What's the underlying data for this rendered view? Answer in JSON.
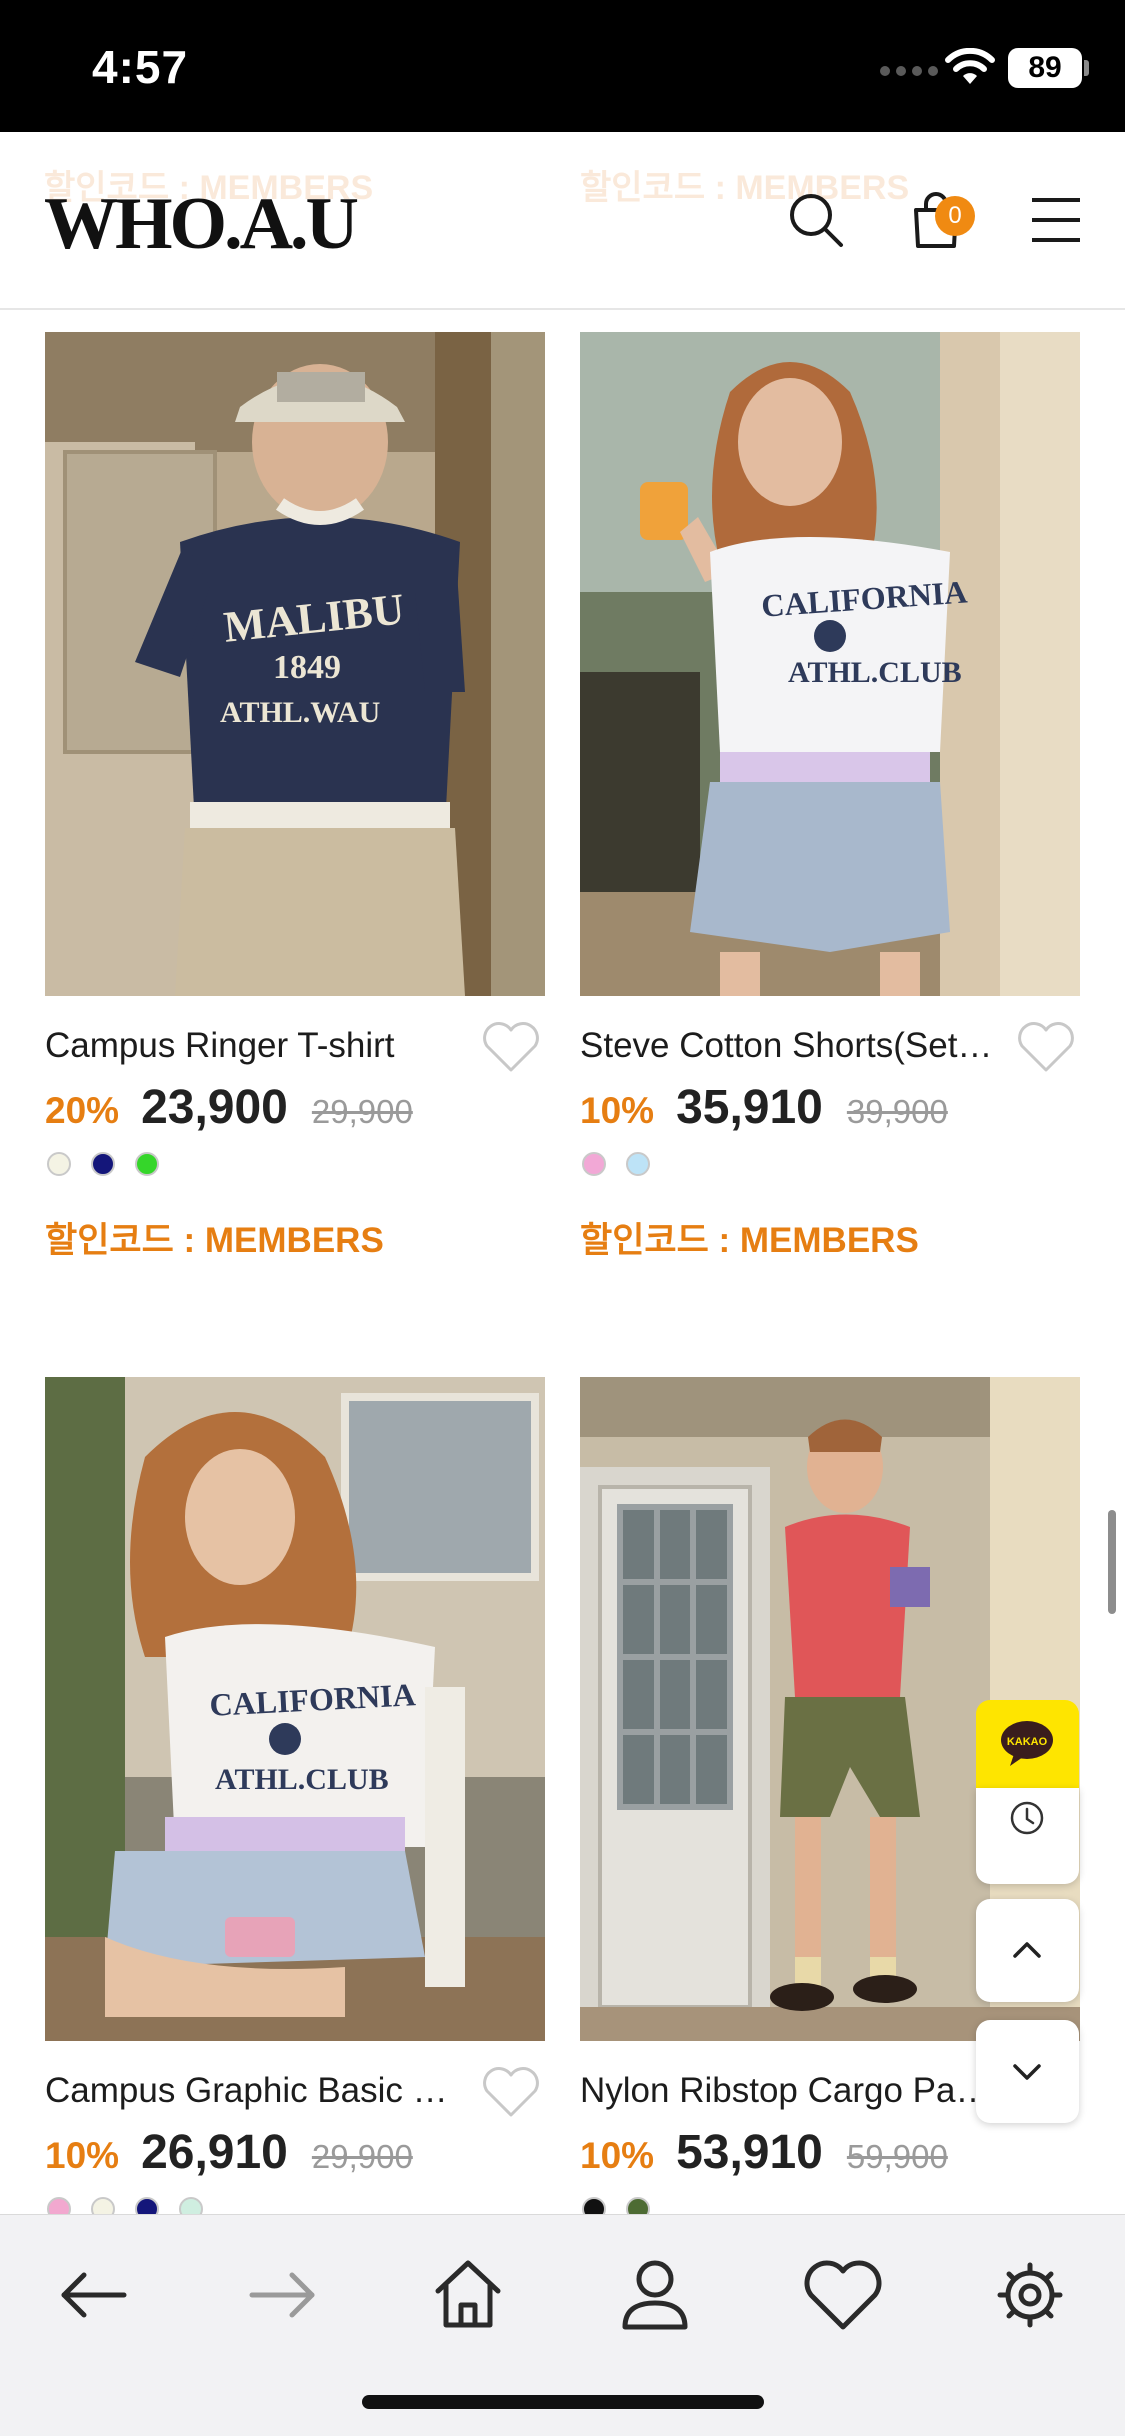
{
  "status_bar": {
    "time": "4:57",
    "battery": "89"
  },
  "header": {
    "logo": "WHO.A.U",
    "cart_count": "0",
    "partial_codes": [
      "할인코드 : MEMBERS",
      "할인코드 : MEMBERS"
    ]
  },
  "products": [
    {
      "name": "Campus Ringer T-shirt",
      "discount": "20%",
      "price": "23,900",
      "original_price": "29,900",
      "swatches": [
        "#f4f3e4",
        "#14167a",
        "#35d62a"
      ],
      "promo_code": "할인코드 : MEMBERS"
    },
    {
      "name": "Steve Cotton Shorts(Set…",
      "discount": "10%",
      "price": "35,910",
      "original_price": "39,900",
      "swatches": [
        "#f2a8d6",
        "#bde3f7"
      ],
      "promo_code": "할인코드 : MEMBERS"
    },
    {
      "name": "Campus Graphic Basic …",
      "discount": "10%",
      "price": "26,910",
      "original_price": "29,900",
      "swatches": [
        "#f2a8cf",
        "#f4f3e4",
        "#14167a",
        "#cfeee0"
      ],
      "promo_code": ""
    },
    {
      "name": "Nylon Ribstop Cargo Pa…",
      "discount": "10%",
      "price": "53,910",
      "original_price": "59,900",
      "swatches": [
        "#111111",
        "#4d6b33"
      ],
      "promo_code": ""
    }
  ],
  "floating": {
    "kakao_label": "KAKAO"
  },
  "icons": {
    "search": "search-icon",
    "cart": "cart-icon",
    "menu": "menu-icon",
    "wishlist": "heart-icon",
    "back": "arrow-left-icon",
    "forward": "arrow-right-icon",
    "home": "home-icon",
    "account": "person-icon",
    "favorites": "heart-icon",
    "settings": "gear-icon",
    "recent": "clock-icon",
    "scroll_up": "chevron-up-icon",
    "scroll_down": "chevron-down-icon"
  },
  "colors": {
    "accent": "#e67e12",
    "badge": "#f08a12",
    "kakao": "#fee500"
  }
}
